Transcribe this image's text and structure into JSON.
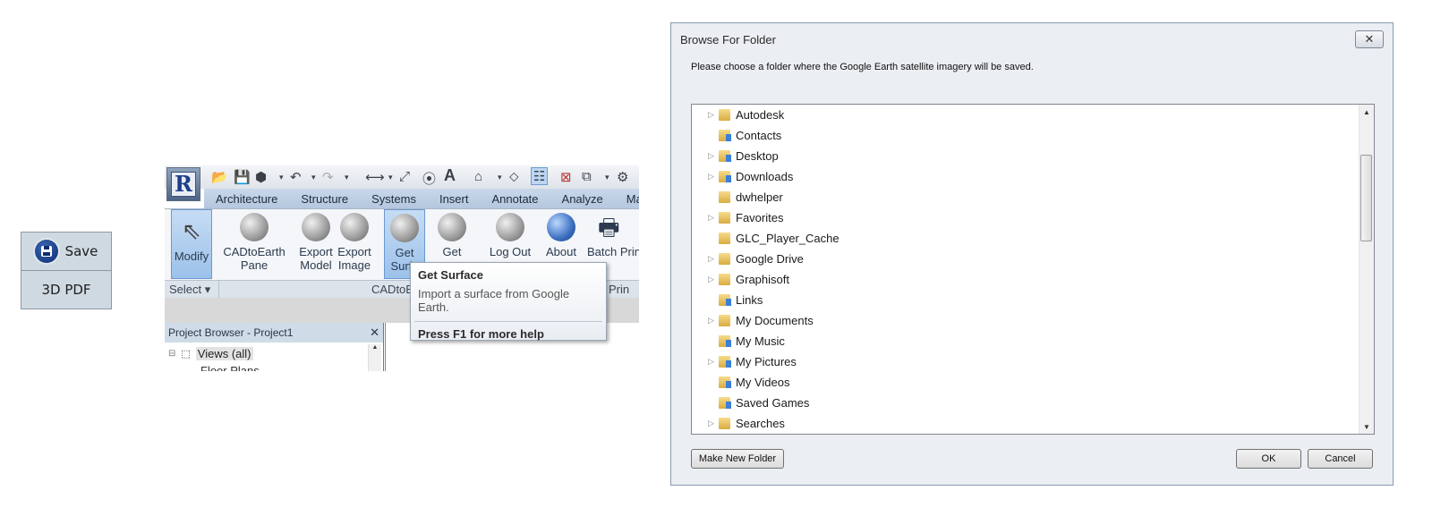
{
  "save_panel": {
    "save_label": "Save",
    "pdf_label": "3D PDF"
  },
  "revit": {
    "logo": "R",
    "tabs": [
      "Architecture",
      "Structure",
      "Systems",
      "Insert",
      "Annotate",
      "Analyze",
      "Massing &"
    ],
    "ribbon_buttons": [
      {
        "label1": "Modify",
        "label2": ""
      },
      {
        "label1": "CADtoEarth",
        "label2": "Pane"
      },
      {
        "label1": "Export",
        "label2": "Model"
      },
      {
        "label1": "Export",
        "label2": "Image"
      },
      {
        "label1": "Get",
        "label2": "Surfa"
      },
      {
        "label1": "Get",
        "label2": ""
      },
      {
        "label1": "Log Out",
        "label2": ""
      },
      {
        "label1": "About",
        "label2": ""
      },
      {
        "label1": "Batch Print",
        "label2": ""
      }
    ],
    "panel_bar": {
      "select": "Select",
      "cadto": "CADtoE",
      "batch": "tch Prin"
    },
    "project_browser": {
      "title": "Project Browser - Project1",
      "close": "✕",
      "views": "Views (all)",
      "floor": "Floor Plans"
    }
  },
  "tooltip": {
    "title": "Get Surface",
    "desc": "Import a surface from Google Earth.",
    "help": "Press F1 for more help"
  },
  "dialog": {
    "title": "Browse For Folder",
    "message": "Please choose a folder where the Google Earth satellite imagery will be saved.",
    "folders": [
      {
        "name": "Autodesk",
        "expand": true,
        "blue": false
      },
      {
        "name": "Contacts",
        "expand": false,
        "blue": true
      },
      {
        "name": "Desktop",
        "expand": true,
        "blue": true
      },
      {
        "name": "Downloads",
        "expand": true,
        "blue": true
      },
      {
        "name": "dwhelper",
        "expand": false,
        "blue": false
      },
      {
        "name": "Favorites",
        "expand": true,
        "blue": false
      },
      {
        "name": "GLC_Player_Cache",
        "expand": false,
        "blue": false
      },
      {
        "name": "Google Drive",
        "expand": true,
        "blue": false
      },
      {
        "name": "Graphisoft",
        "expand": true,
        "blue": false
      },
      {
        "name": "Links",
        "expand": false,
        "blue": true
      },
      {
        "name": "My Documents",
        "expand": true,
        "blue": false
      },
      {
        "name": "My Music",
        "expand": false,
        "blue": true
      },
      {
        "name": "My Pictures",
        "expand": true,
        "blue": true
      },
      {
        "name": "My Videos",
        "expand": false,
        "blue": true
      },
      {
        "name": "Saved Games",
        "expand": false,
        "blue": true
      },
      {
        "name": "Searches",
        "expand": true,
        "blue": false
      }
    ],
    "make_new_folder": "Make New Folder",
    "ok": "OK",
    "cancel": "Cancel"
  }
}
